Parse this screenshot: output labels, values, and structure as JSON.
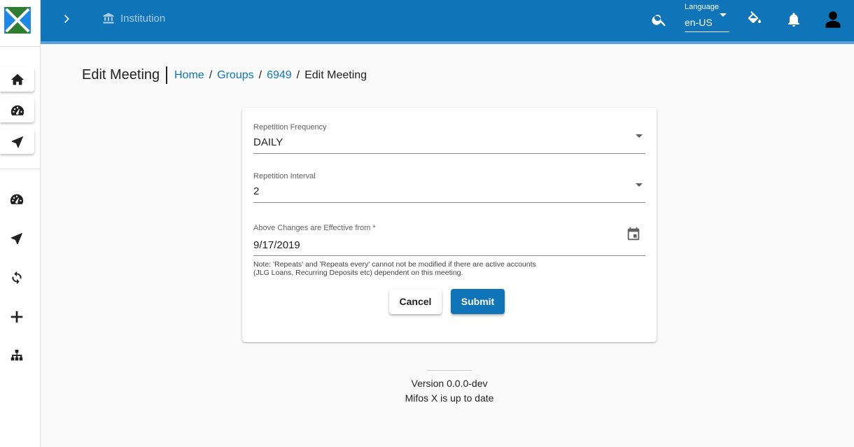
{
  "sidebar": {
    "logo": "mifos-x-logo",
    "pinned_items": [
      {
        "icon": "home-icon"
      },
      {
        "icon": "dashboard-icon"
      },
      {
        "icon": "navigation-icon"
      }
    ],
    "items": [
      {
        "icon": "dashboard-icon"
      },
      {
        "icon": "navigation-icon"
      },
      {
        "icon": "refresh-icon"
      },
      {
        "icon": "plus-icon"
      },
      {
        "icon": "sitemap-icon"
      }
    ]
  },
  "topbar": {
    "institution_label": "Institution",
    "language_label": "Language",
    "language_value": "en-US",
    "colors": {
      "primary": "#1074b9",
      "accent_line": "#5aa0da"
    }
  },
  "page": {
    "title": "Edit Meeting",
    "breadcrumb": [
      {
        "label": "Home",
        "link": true
      },
      {
        "label": "Groups",
        "link": true
      },
      {
        "label": "6949",
        "link": true
      },
      {
        "label": "Edit Meeting",
        "link": false
      }
    ],
    "separator": "/"
  },
  "form": {
    "repetition_frequency": {
      "label": "Repetition Frequency",
      "value": "DAILY"
    },
    "repetition_interval": {
      "label": "Repetition Interval",
      "value": "2"
    },
    "effective_from": {
      "label": "Above Changes are Effective from *",
      "value": "9/17/2019"
    },
    "note_line1": "Note: 'Repeats' and 'Repeats every' cannot not be modified if there are active accounts",
    "note_line2": "(JLG Loans, Recurring Deposits etc) dependent on this meeting.",
    "cancel_label": "Cancel",
    "submit_label": "Submit"
  },
  "footer": {
    "version": "Version 0.0.0-dev",
    "status": "Mifos X is up to date"
  }
}
